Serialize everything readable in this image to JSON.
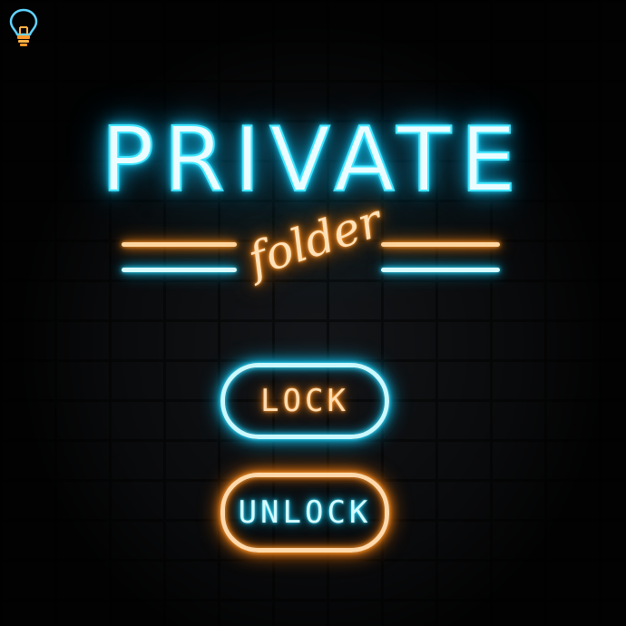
{
  "app": {
    "icon": "lightbulb-icon"
  },
  "header": {
    "title": "PRIVATE",
    "subtitle": "folder"
  },
  "actions": {
    "lock_label": "LOCK",
    "unlock_label": "UNLOCK"
  },
  "colors": {
    "neon_cyan": "#35e0ff",
    "neon_orange": "#ff9a2a",
    "wall": "#15171a"
  }
}
